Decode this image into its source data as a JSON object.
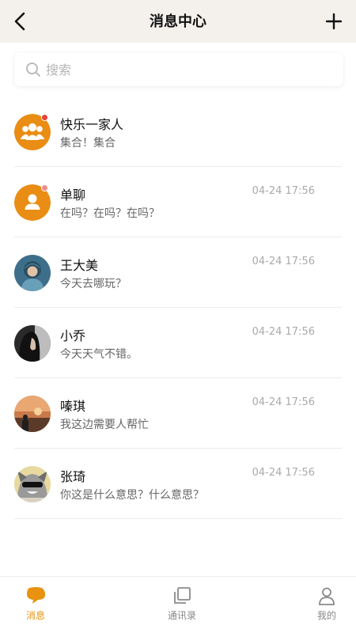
{
  "header": {
    "title": "消息中心"
  },
  "search": {
    "placeholder": "搜索"
  },
  "conversations": [
    {
      "name": "快乐一家人",
      "preview": "集合！集合",
      "time": "",
      "avatar": "group-icon",
      "unread": true
    },
    {
      "name": "单聊",
      "preview": "在吗？在吗？在吗？",
      "time": "04-24 17:56",
      "avatar": "user-icon",
      "unread": true
    },
    {
      "name": "王大美",
      "preview": "今天去哪玩？",
      "time": "04-24 17:56",
      "avatar": "photo"
    },
    {
      "name": "小乔",
      "preview": "今天天气不错。",
      "time": "04-24 17:56",
      "avatar": "photo"
    },
    {
      "name": "嗪琪",
      "preview": "我这边需要人帮忙",
      "time": "04-24 17:56",
      "avatar": "photo"
    },
    {
      "name": "张琦",
      "preview": "你这是什么意思？什么意思？",
      "time": "04-24 17:56",
      "avatar": "photo"
    }
  ],
  "tabs": [
    {
      "label": "消息",
      "icon": "chat-icon",
      "active": true
    },
    {
      "label": "通讯录",
      "icon": "contacts-icon"
    },
    {
      "label": "我的",
      "icon": "profile-icon"
    }
  ],
  "colors": {
    "accent": "#e8920f",
    "unread_dot": "#e8403a",
    "header_bg": "#f4f1ec"
  }
}
